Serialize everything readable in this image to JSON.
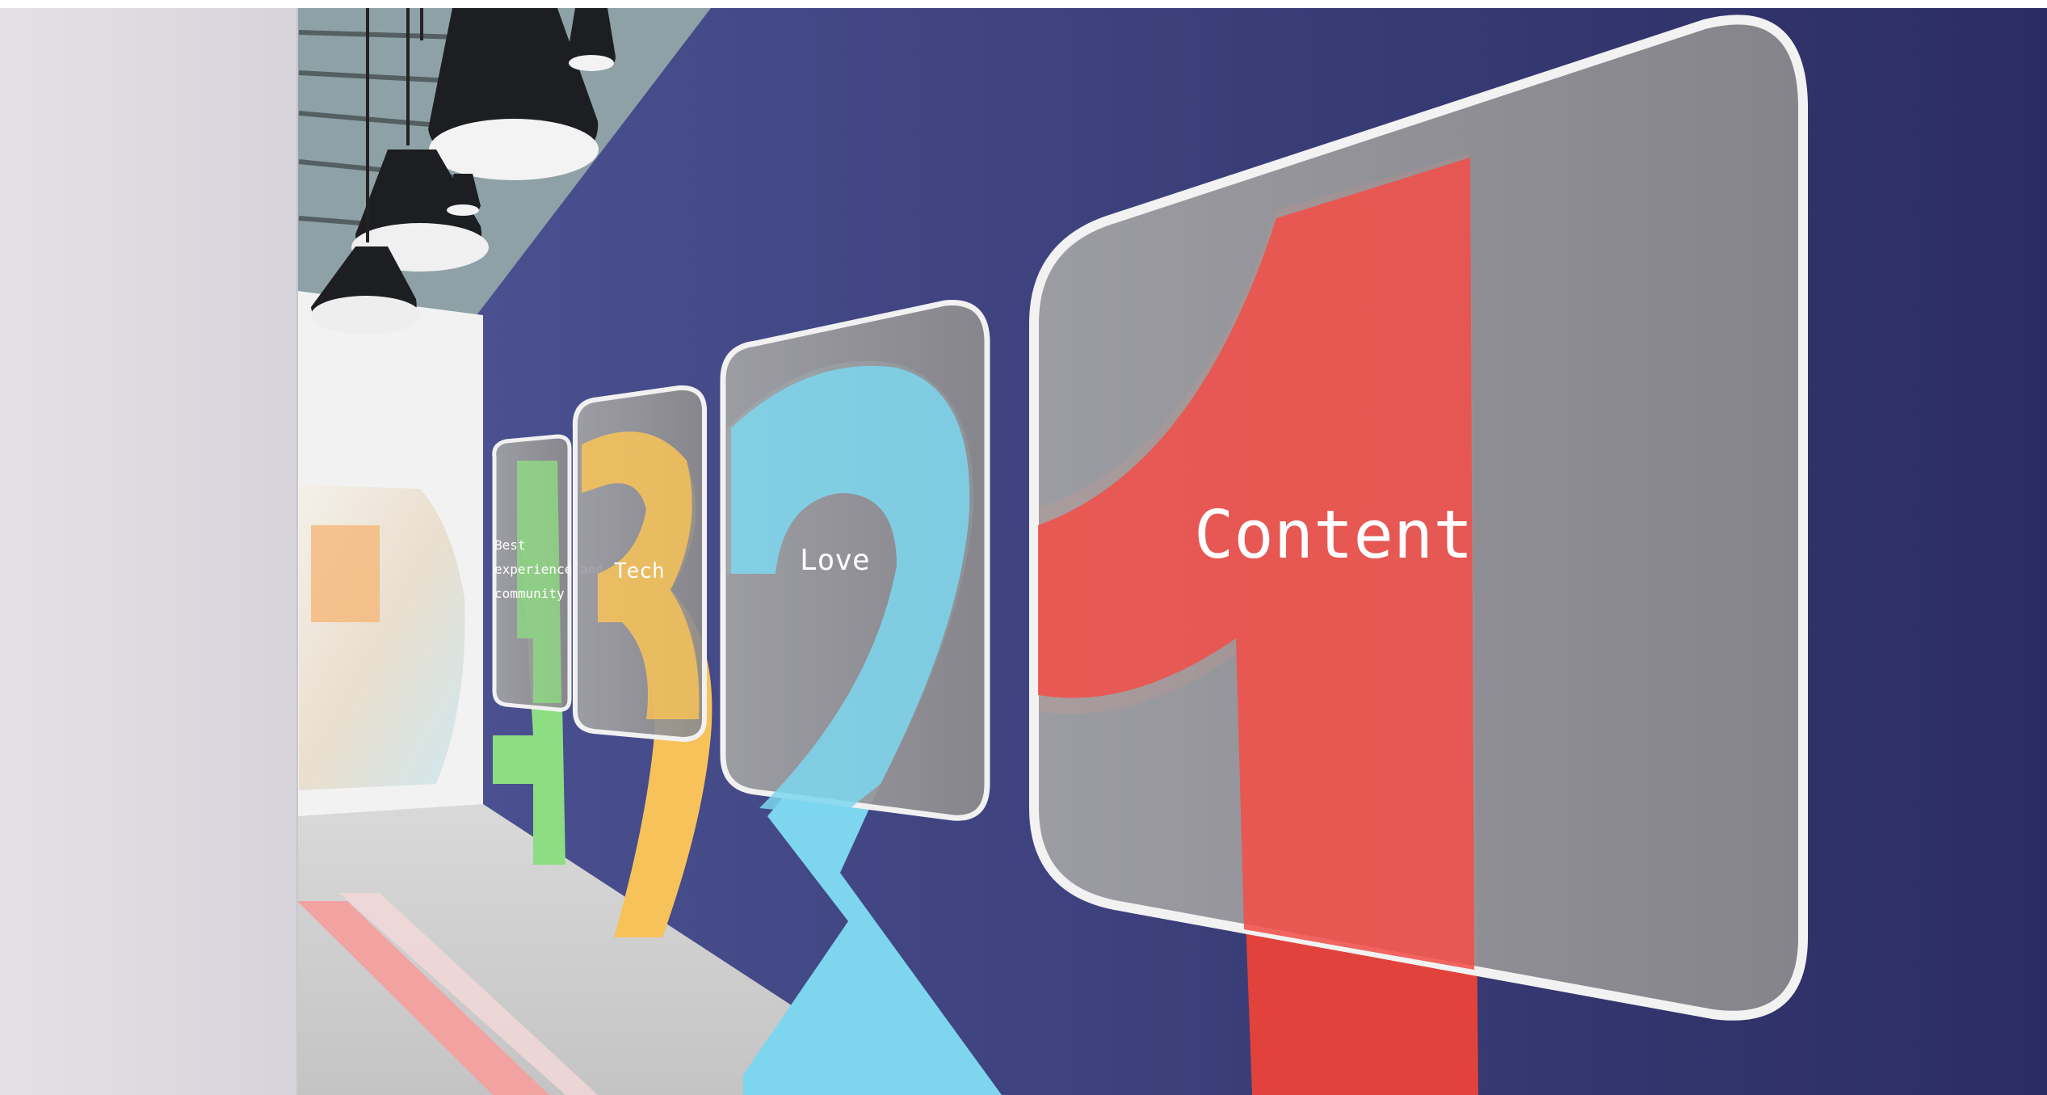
{
  "colors": {
    "wall_navy": "#3b3f7a",
    "wall_navy_dark": "#2b2d62",
    "number1_red": "#f0504a",
    "number2_cyan": "#7dd6ee",
    "number3_yellow": "#f7c259",
    "number4_green": "#8dde82",
    "panel_grey": "#9a9a9c",
    "panel_edge": "#f1f1f1",
    "floor": "#cfcfcf",
    "left_wall": "#e9e6ea",
    "lamp_black": "#1d1e22"
  },
  "panels": {
    "one": {
      "numeral": "1",
      "label": "Content"
    },
    "two": {
      "numeral": "2",
      "label": "Love"
    },
    "three": {
      "numeral": "3",
      "label": "Tech"
    },
    "four": {
      "numeral": "4",
      "label_lines": [
        "Best",
        "experience and",
        "community"
      ]
    }
  },
  "icons": [
    "pendant-lamp-icon"
  ]
}
